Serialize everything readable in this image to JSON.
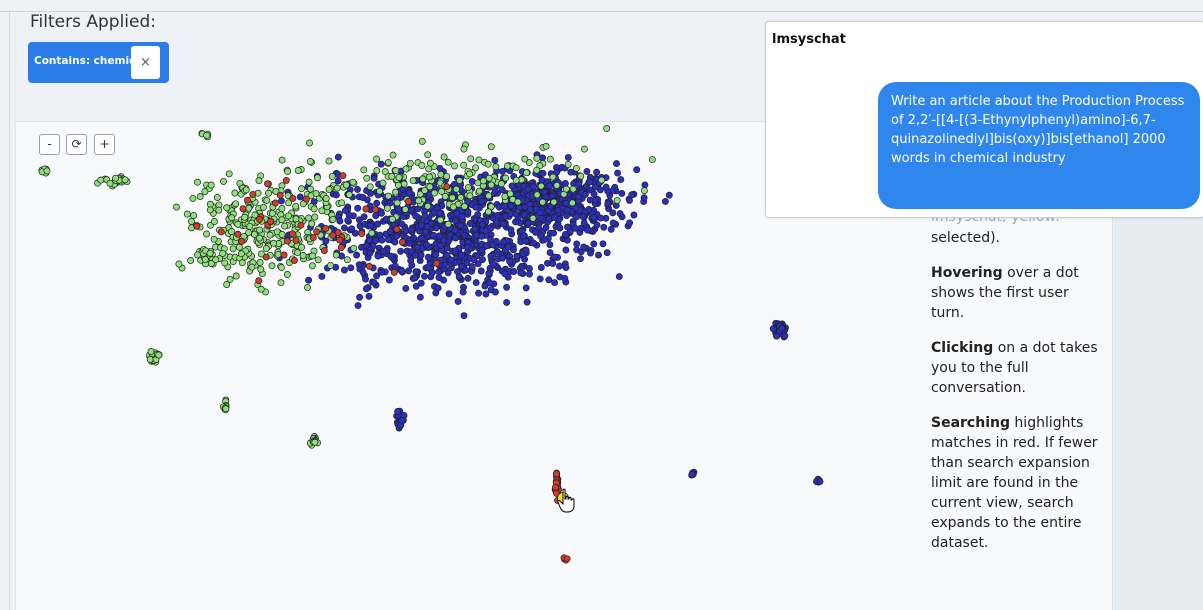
{
  "filters": {
    "title": "Filters Applied:",
    "chip_label": "Contains: chemical",
    "chip_close": "×"
  },
  "zoom": {
    "out": "-",
    "reset": "⟳",
    "in": "+"
  },
  "help": {
    "cut_line": "lmsyschat; yellow:",
    "p1_rest": "selected).",
    "hover_bold": "Hovering",
    "hover_rest": " over a dot shows the first user turn.",
    "click_bold": "Clicking",
    "click_rest": " on a dot takes you to the full conversation.",
    "search_bold": "Searching",
    "search_rest": " highlights matches in red. If fewer than search expansion limit are found in the current view, search expands to the entire dataset."
  },
  "chat": {
    "title": "lmsyschat",
    "message": "Write an article about the Production Process of 2,2′-[[4-[(3-Ethynylphenyl)amino]-6,7-quinazolinediyl]bis(oxy)]bis[ethanol] 2000 words in chemical industry"
  },
  "colors": {
    "accent": "#2b7de9",
    "bubble": "#2f86ed",
    "dot_blue": "#2a2fbf",
    "dot_green": "#8ee07a",
    "dot_red": "#d23c2a",
    "dot_yellow": "#f2e51c"
  },
  "legend_meaning": {
    "red": "search match",
    "yellow": "selected"
  }
}
